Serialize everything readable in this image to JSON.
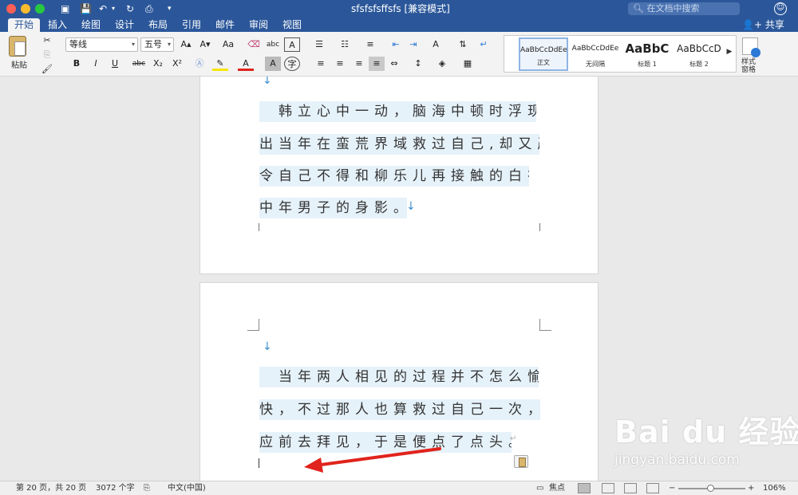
{
  "window": {
    "title": "sfsfsfsffsfs [兼容模式]",
    "search_placeholder": "在文档中搜索",
    "share_label": "共享"
  },
  "tabs": [
    "开始",
    "插入",
    "绘图",
    "设计",
    "布局",
    "引用",
    "邮件",
    "审阅",
    "视图"
  ],
  "ribbon": {
    "paste_label": "粘贴",
    "font_name": "等线",
    "font_size": "五号",
    "styles": [
      {
        "preview": "AaBbCcDdEe",
        "name": "正文"
      },
      {
        "preview": "AaBbCcDdEe",
        "name": "无间隔"
      },
      {
        "preview": "AaBbC",
        "name": "标题 1"
      },
      {
        "preview": "AaBbCcD",
        "name": "标题 2"
      }
    ],
    "styles_pane_label": "样式窗格",
    "buttons": {
      "bold": "B",
      "italic": "I",
      "underline": "U",
      "strike": "abc",
      "sub": "X₂",
      "sup": "X²",
      "grow": "A▴",
      "shrink": "A▾",
      "case": "Aa",
      "phonetic": "abc",
      "char_border": "A",
      "font_color": "A",
      "char_shading": "A",
      "enclose": "字"
    }
  },
  "document": {
    "page1_lines": [
      "　韩立心中一动，脑海中顿时浮现",
      "出当年在蛮荒界域救过自己,却又严",
      "令自己不得和柳乐儿再接触的白衣",
      "中年男子的身影。"
    ],
    "page2_lines": [
      "　当年两人相见的过程并不怎么愉",
      "快，不过那人也算救过自己一次，理",
      "应前去拜见，于是便点了点头。"
    ],
    "para_mark": "↵",
    "down_mark": "↓"
  },
  "watermark": {
    "brand": "Bai du 经验",
    "url": "jingyan.baidu.com"
  },
  "statusbar": {
    "page": "第 20 页，共 20 页",
    "words": "3072 个字",
    "language": "中文(中国)",
    "focus": "焦点",
    "zoom": "106%"
  },
  "colors": {
    "brand": "#2b579a",
    "highlight": "#e6f2fa",
    "arrow": "#e0231c"
  }
}
